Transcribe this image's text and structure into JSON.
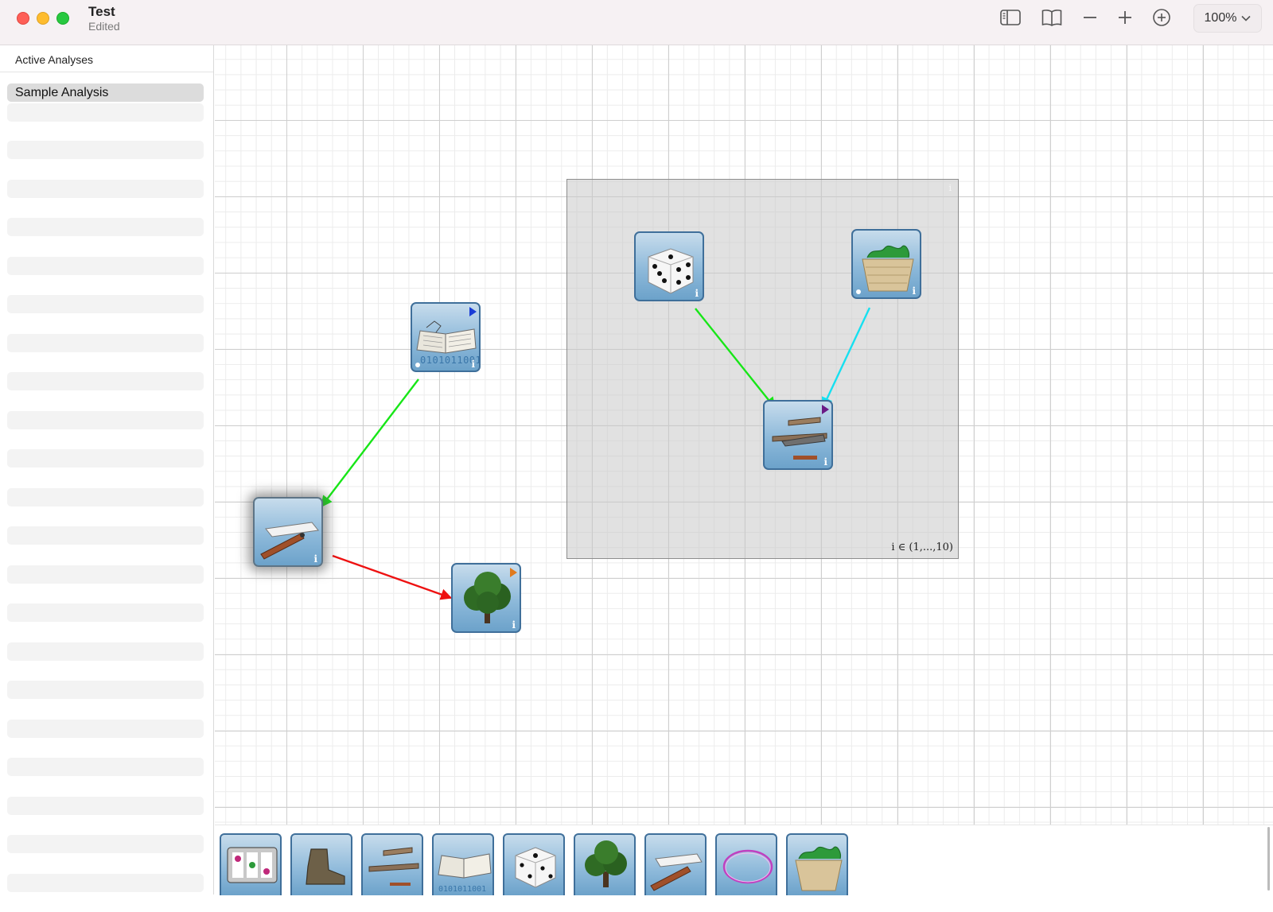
{
  "window": {
    "title": "Test",
    "subtitle": "Edited",
    "zoom": "100%"
  },
  "toolbar": {
    "icons": [
      "sidebar-icon",
      "book-icon",
      "minus-icon",
      "plus-icon",
      "plus-circle-icon",
      "chevron-down-icon"
    ]
  },
  "sidebar": {
    "header": "Active Analyses",
    "items": [
      {
        "label": "Sample Analysis",
        "selected": true
      }
    ]
  },
  "canvas": {
    "plate": {
      "label": "i ∈ (1,...,10)",
      "info": "i"
    },
    "nodes": [
      {
        "name": "book-data-node",
        "icon": "book-icon",
        "bits": "0101011001",
        "flag_color": "#1a3dd6",
        "info": "i"
      },
      {
        "name": "razor-node",
        "icon": "razor-icon",
        "info": "i",
        "selected": true
      },
      {
        "name": "tree-node",
        "icon": "tree-icon",
        "flag_color": "#e07a1e",
        "info": "i"
      },
      {
        "name": "dice-node",
        "icon": "dice-icon",
        "info": "i"
      },
      {
        "name": "basket-node",
        "icon": "basket-icon",
        "info": "i"
      },
      {
        "name": "airplane-node",
        "icon": "airplane-icon",
        "flag_color": "#6a1a86",
        "info": "i"
      }
    ],
    "edges": [
      {
        "from": "book-data-node",
        "to": "razor-node",
        "color": "#17e617"
      },
      {
        "from": "razor-node",
        "to": "tree-node",
        "color": "#ee1111"
      },
      {
        "from": "dice-node",
        "to": "airplane-node",
        "color": "#17e617"
      },
      {
        "from": "basket-node",
        "to": "airplane-node",
        "color": "#16e0f0"
      }
    ]
  },
  "palette": {
    "items": [
      "slot-machine-icon",
      "boot-icon",
      "airplane-icon",
      "book-icon",
      "dice-icon",
      "tree-icon",
      "razor-icon",
      "ring-icon",
      "basket-icon"
    ],
    "book_bits": "0101011001"
  }
}
